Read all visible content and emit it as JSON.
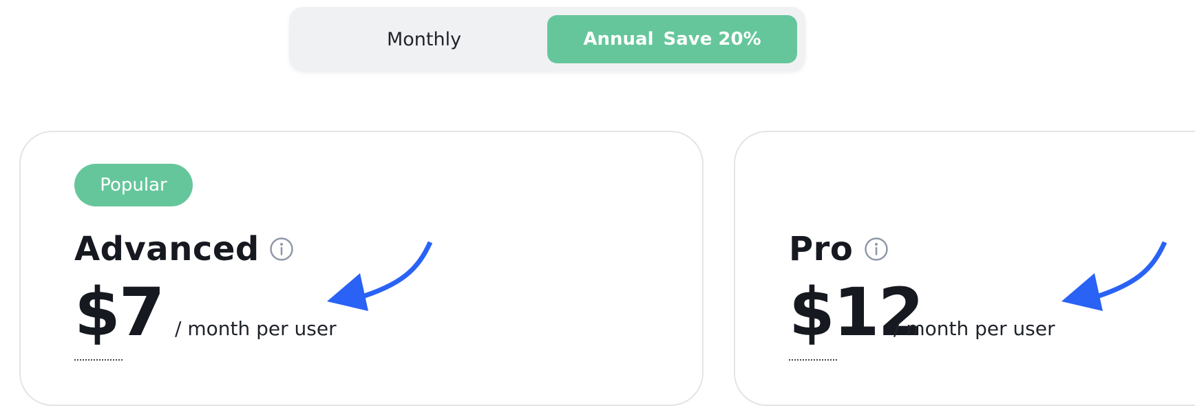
{
  "billing_toggle": {
    "monthly_label": "Monthly",
    "annual_label": "Annual",
    "annual_savings": "Save 20%",
    "selected": "Annual"
  },
  "plans": [
    {
      "badge": "Popular",
      "name": "Advanced",
      "price": "$7",
      "period": "/ month per user",
      "info_icon": "info-circle-icon"
    },
    {
      "badge": "",
      "name": "Pro",
      "price": "$12",
      "period": "/ month per user",
      "info_icon": "info-circle-icon"
    }
  ],
  "annotation": {
    "arrow_icon": "curved-arrow-icon",
    "arrow_color": "#2962f4"
  },
  "colors": {
    "accent": "#66c69b",
    "text": "#16191f",
    "toggle_bg": "#f0f1f3",
    "card_border": "#e3e4e6",
    "info_icon": "#8f98a8"
  }
}
